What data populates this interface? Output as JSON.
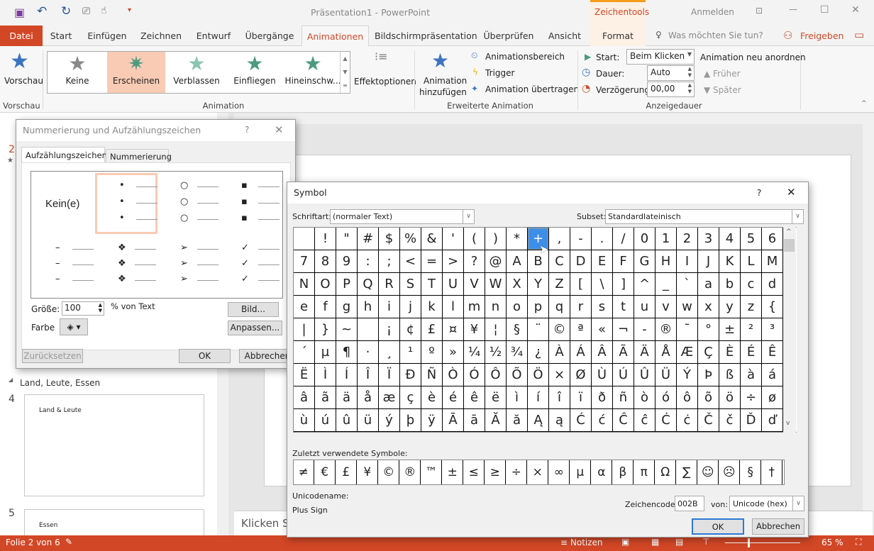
{
  "titlebar": {
    "title": "Präsentation1  -  PowerPoint",
    "context_tab": "Zeichentools",
    "signin": "Anmelden"
  },
  "tabs": [
    "Datei",
    "Start",
    "Einfügen",
    "Zeichnen",
    "Entwurf",
    "Übergänge",
    "Animationen",
    "Bildschirmpräsentation",
    "Überprüfen",
    "Ansicht",
    "Format"
  ],
  "tell_me": "Was möchten Sie tun?",
  "share": "Freigeben",
  "ribbon": {
    "preview": "Vorschau",
    "preview_group": "Vorschau",
    "gallery": [
      "Keine",
      "Erscheinen",
      "Verblassen",
      "Einfliegen",
      "Hineinschw..."
    ],
    "effect_options": "Effektoptionen",
    "animation_group": "Animation",
    "add_animation_1": "Animation",
    "add_animation_2": "hinzufügen",
    "animation_pane": "Animationsbereich",
    "trigger": "Trigger",
    "painter": "Animation übertragen",
    "advanced_group": "Erweiterte Animation",
    "start_label": "Start:",
    "start_value": "Beim Klicken",
    "duration_label": "Dauer:",
    "duration_value": "Auto",
    "delay_label": "Verzögerung:",
    "delay_value": "00,00",
    "timing_group": "Anzeigedauer",
    "reorder": "Animation neu anordnen",
    "earlier": "Früher",
    "later": "Später"
  },
  "leftpane": {
    "slide2_num": "2",
    "section": "Land, Leute, Essen",
    "slide4_num": "4",
    "slide4_title": "Land & Leute",
    "slide5_num": "5",
    "slide5_title": "Essen"
  },
  "notes_placeholder": "Klicken Sie",
  "status": {
    "slide": "Folie 2 von 6",
    "notes": "Notizen",
    "zoom": "65 %"
  },
  "bullets_dialog": {
    "title": "Nummerierung und Aufzählungszeichen",
    "help": "?",
    "tabs": [
      "Aufzählungszeichen",
      "Nummerierung"
    ],
    "none": "Kein(e)",
    "bullet_glyphs": [
      "•",
      "○",
      "▪",
      "–",
      "❖",
      "➢",
      "✓"
    ],
    "size_label": "Größe:",
    "size_value": "100",
    "size_unit": "% von Text",
    "color_label": "Farbe",
    "picture": "Bild...",
    "customize": "Anpassen...",
    "reset": "Zurücksetzen",
    "ok": "OK",
    "cancel": "Abbrechen"
  },
  "symbol_dialog": {
    "title": "Symbol",
    "help": "?",
    "font_label": "Schriftart:",
    "font_value": "(normaler Text)",
    "subset_label": "Subset:",
    "subset_value": "Standardlateinisch",
    "grid": [
      [
        " ",
        "!",
        "\"",
        "#",
        "$",
        "%",
        "&",
        "'",
        "(",
        ")",
        "*",
        "+",
        ",",
        "-",
        ".",
        "/",
        "0",
        "1",
        "2",
        "3",
        "4",
        "5",
        "6"
      ],
      [
        "7",
        "8",
        "9",
        ":",
        ";",
        "<",
        "=",
        ">",
        "?",
        "@",
        "A",
        "B",
        "C",
        "D",
        "E",
        "F",
        "G",
        "H",
        "I",
        "J",
        "K",
        "L",
        "M"
      ],
      [
        "N",
        "O",
        "P",
        "Q",
        "R",
        "S",
        "T",
        "U",
        "V",
        "W",
        "X",
        "Y",
        "Z",
        "[",
        "\\",
        "]",
        "^",
        "_",
        "`",
        "a",
        "b",
        "c",
        "d"
      ],
      [
        "e",
        "f",
        "g",
        "h",
        "i",
        "j",
        "k",
        "l",
        "m",
        "n",
        "o",
        "p",
        "q",
        "r",
        "s",
        "t",
        "u",
        "v",
        "w",
        "x",
        "y",
        "z",
        "{"
      ],
      [
        "|",
        "}",
        "~",
        " ",
        "¡",
        "¢",
        "£",
        "¤",
        "¥",
        "¦",
        "§",
        "¨",
        "©",
        "ª",
        "«",
        "¬",
        "-",
        "®",
        "¯",
        "°",
        "±",
        "²",
        "³"
      ],
      [
        "´",
        "µ",
        "¶",
        "·",
        "¸",
        "¹",
        "º",
        "»",
        "¼",
        "½",
        "¾",
        "¿",
        "À",
        "Á",
        "Â",
        "Ã",
        "Ä",
        "Å",
        "Æ",
        "Ç",
        "È",
        "É",
        "Ê"
      ],
      [
        "Ë",
        "Ì",
        "Í",
        "Î",
        "Ï",
        "Ð",
        "Ñ",
        "Ò",
        "Ó",
        "Ô",
        "Õ",
        "Ö",
        "×",
        "Ø",
        "Ù",
        "Ú",
        "Û",
        "Ü",
        "Ý",
        "Þ",
        "ß",
        "à",
        "á"
      ],
      [
        "â",
        "ã",
        "ä",
        "å",
        "æ",
        "ç",
        "è",
        "é",
        "ê",
        "ë",
        "ì",
        "í",
        "î",
        "ï",
        "ð",
        "ñ",
        "ò",
        "ó",
        "ô",
        "õ",
        "ö",
        "÷",
        "ø"
      ],
      [
        "ù",
        "ú",
        "û",
        "ü",
        "ý",
        "þ",
        "ÿ",
        "Ā",
        "ā",
        "Ă",
        "ă",
        "Ą",
        "ą",
        "Ć",
        "ć",
        "Ĉ",
        "ĉ",
        "Ċ",
        "ċ",
        "Č",
        "č",
        "Ď",
        "ď"
      ]
    ],
    "selected": "+",
    "recent_label": "Zuletzt verwendete Symbole:",
    "recent": [
      "≠",
      "€",
      "£",
      "¥",
      "©",
      "®",
      "™",
      "±",
      "≤",
      "≥",
      "÷",
      "×",
      "∞",
      "µ",
      "α",
      "β",
      "π",
      "Ω",
      "∑",
      "☺",
      "☹",
      "§",
      "†"
    ],
    "unicode_name_label": "Unicodename:",
    "unicode_name": "Plus Sign",
    "code_label": "Zeichencode:",
    "code_value": "002B",
    "from_label": "von:",
    "from_value": "Unicode (hex)",
    "ok": "OK",
    "cancel": "Abbrechen"
  },
  "colors": {
    "accent": "#d24726",
    "selection": "#3d8ee8",
    "gallery_selected": "#f9cbb4"
  }
}
